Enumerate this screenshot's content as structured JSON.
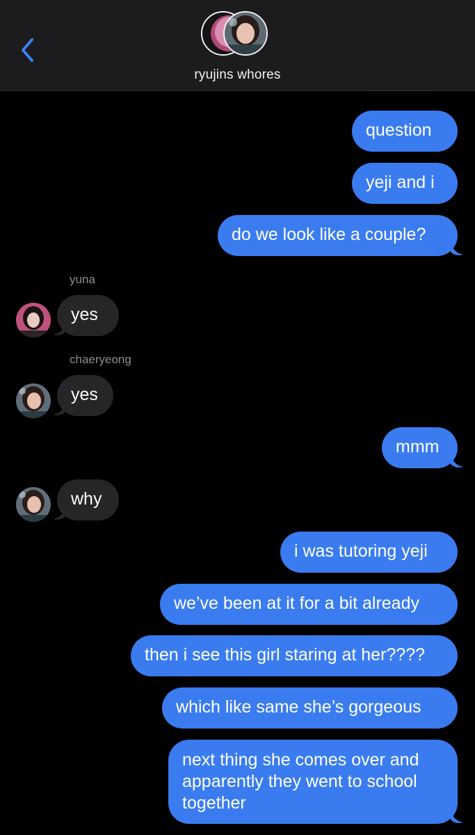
{
  "header": {
    "group_name": "ryujins whores",
    "back_icon": "chevron-left-icon",
    "accent": "#3a82f7"
  },
  "colors": {
    "outgoing": "#3a7cf0",
    "incoming": "#262628",
    "background": "#000000",
    "header_bg": "#1c1c1e"
  },
  "messages": [
    {
      "dir": "out",
      "text": "question"
    },
    {
      "dir": "out",
      "text": "yeji and i"
    },
    {
      "dir": "out",
      "text": "do we look like a couple?"
    },
    {
      "dir": "in",
      "sender": "yuna",
      "text": "yes"
    },
    {
      "dir": "in",
      "sender": "chaeryeong",
      "text": "yes"
    },
    {
      "dir": "out",
      "text": "mmm"
    },
    {
      "dir": "in",
      "text": "why"
    },
    {
      "dir": "out",
      "text": "i was tutoring yeji"
    },
    {
      "dir": "out",
      "text": "we’ve been at it for a bit already"
    },
    {
      "dir": "out",
      "text": "then i see this girl staring at her????"
    },
    {
      "dir": "out",
      "text": "which like same she’s gorgeous"
    },
    {
      "dir": "out",
      "text": "next thing she comes over and apparently they went to school together"
    }
  ]
}
